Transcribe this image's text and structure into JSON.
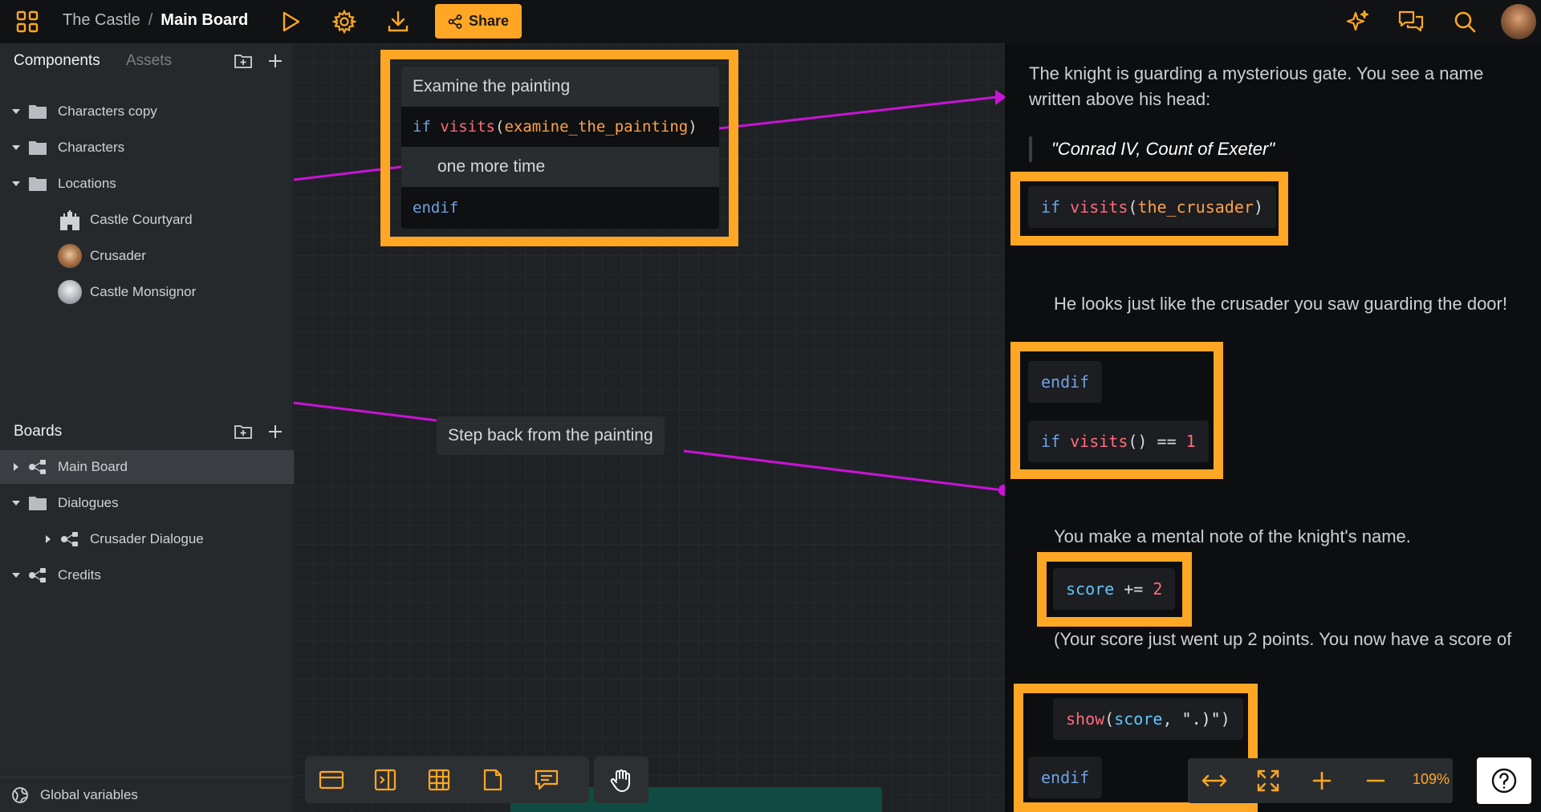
{
  "header": {
    "project": "The Castle",
    "separator": "/",
    "board": "Main Board",
    "share_label": "Share",
    "accent": "#ffa724"
  },
  "sidebar": {
    "components_tab": "Components",
    "assets_tab": "Assets",
    "component_items": [
      {
        "label": "Characters copy",
        "icon": "folder-icon"
      },
      {
        "label": "Characters",
        "icon": "folder-icon"
      },
      {
        "label": "Locations",
        "icon": "folder-icon"
      },
      {
        "label": "Castle Courtyard",
        "icon": "castle-icon"
      },
      {
        "label": "Crusader",
        "icon": "avatar"
      },
      {
        "label": "Castle Monsignor",
        "icon": "avatar"
      }
    ],
    "boards_title": "Boards",
    "board_items": [
      {
        "label": "Main Board",
        "icon": "board-icon"
      },
      {
        "label": "Dialogues",
        "icon": "folder-icon"
      },
      {
        "label": "Crusader Dialogue",
        "icon": "board-icon"
      },
      {
        "label": "Credits",
        "icon": "board-icon"
      }
    ],
    "global_variables": "Global variables"
  },
  "canvas": {
    "node1": {
      "title": "Examine the painting",
      "cond_kw": "if",
      "cond_fn": "visits",
      "cond_open": "(",
      "cond_arg": "examine_the_painting",
      "cond_close": ")",
      "body": "one more time",
      "endif": "endif"
    },
    "node2": {
      "title": "Step back from the painting"
    },
    "link_color": "#c913d6"
  },
  "panel": {
    "p1": "The knight is guarding a mysterious gate. You see a name written above his head:",
    "quote": "\"Conrad IV, Count of Exeter\"",
    "code1": {
      "kw": "if",
      "fn": "visits",
      "open": "(",
      "arg": "the_crusader",
      "close": ")"
    },
    "p2": "He looks just like the crusader you saw guarding the door!",
    "endif1": "endif",
    "code2": {
      "kw": "if",
      "fn": "visits",
      "call": "()",
      "op": " == ",
      "num": "1"
    },
    "p3": "You make a mental note of the knight's name.",
    "code3": {
      "var": "score",
      "op": " += ",
      "num": "2"
    },
    "p4": "(Your score just went up 2 points. You now have a score of",
    "code4": {
      "fn": "show",
      "open": "(",
      "var": "score",
      "sep": ", ",
      "str": "\".)\"",
      "close": ")"
    },
    "endif2": "endif"
  },
  "zoom": {
    "level": "109%"
  }
}
